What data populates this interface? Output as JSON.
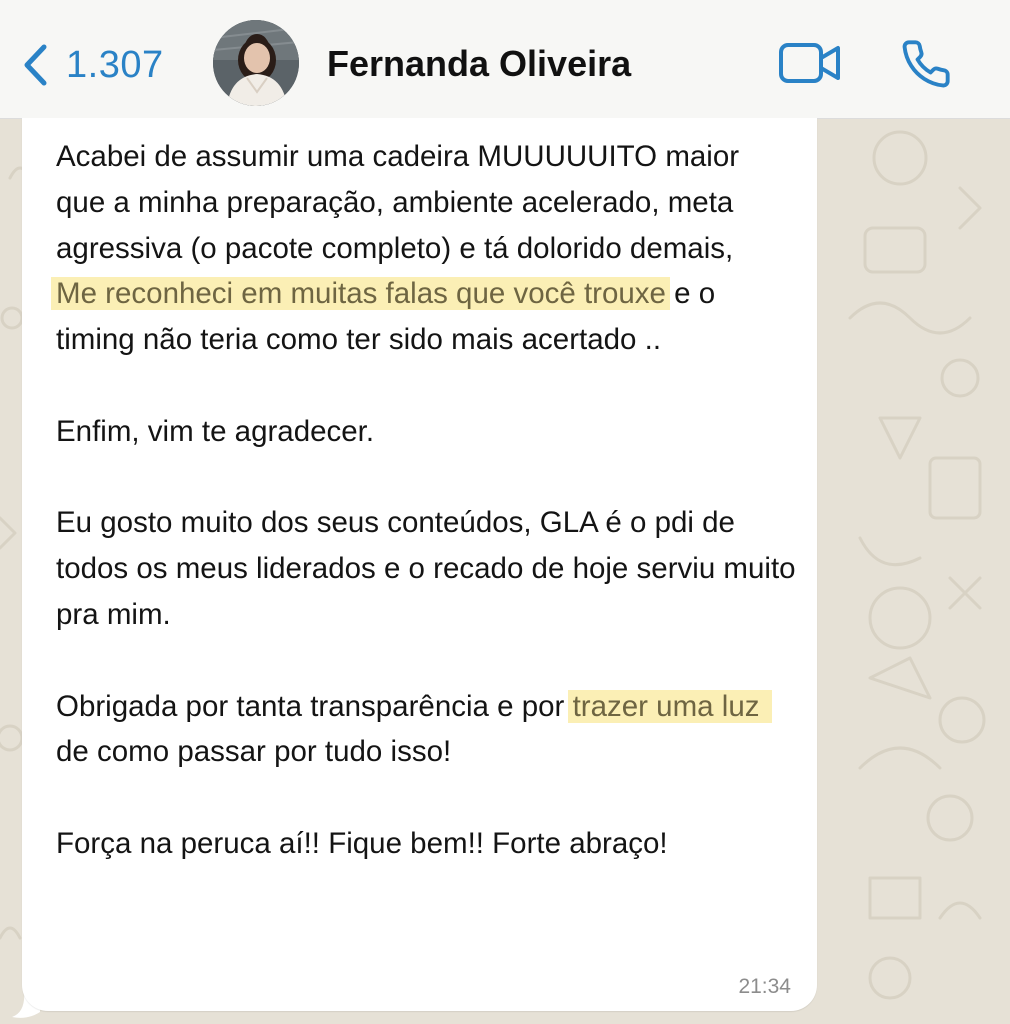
{
  "header": {
    "back_label": "1.307",
    "contact_name": "Fernanda Oliveira",
    "icons": {
      "back": "chevron-left-icon",
      "video": "video-camera-icon",
      "call": "phone-icon"
    },
    "accent_color": "#2a82c6"
  },
  "message": {
    "p1_a": "Acabei de assumir uma cadeira MUUUUUITO maior que a minha preparação, ambiente acelerado, meta agressiva (o pacote completo) e tá dolorido demais,",
    "p1_highlight": "Me reconheci em muitas falas que você trouxe",
    "p1_b": " e o timing não teria como ter sido mais acertado ..",
    "p2": "Enfim, vim te agradecer.",
    "p3": "Eu gosto muito dos seus conteúdos, GLA é o pdi de todos os meus liderados e o recado de hoje serviu muito pra mim.",
    "p4_a": "Obrigada por tanta transparência e por ",
    "p4_highlight": "trazer uma luz ",
    "p4_b": "de como passar por tudo isso!",
    "p5": "Força na peruca aí!! Fique bem!! Forte abraço!",
    "time": "21:34",
    "highlight_color": "#fbefb5"
  }
}
